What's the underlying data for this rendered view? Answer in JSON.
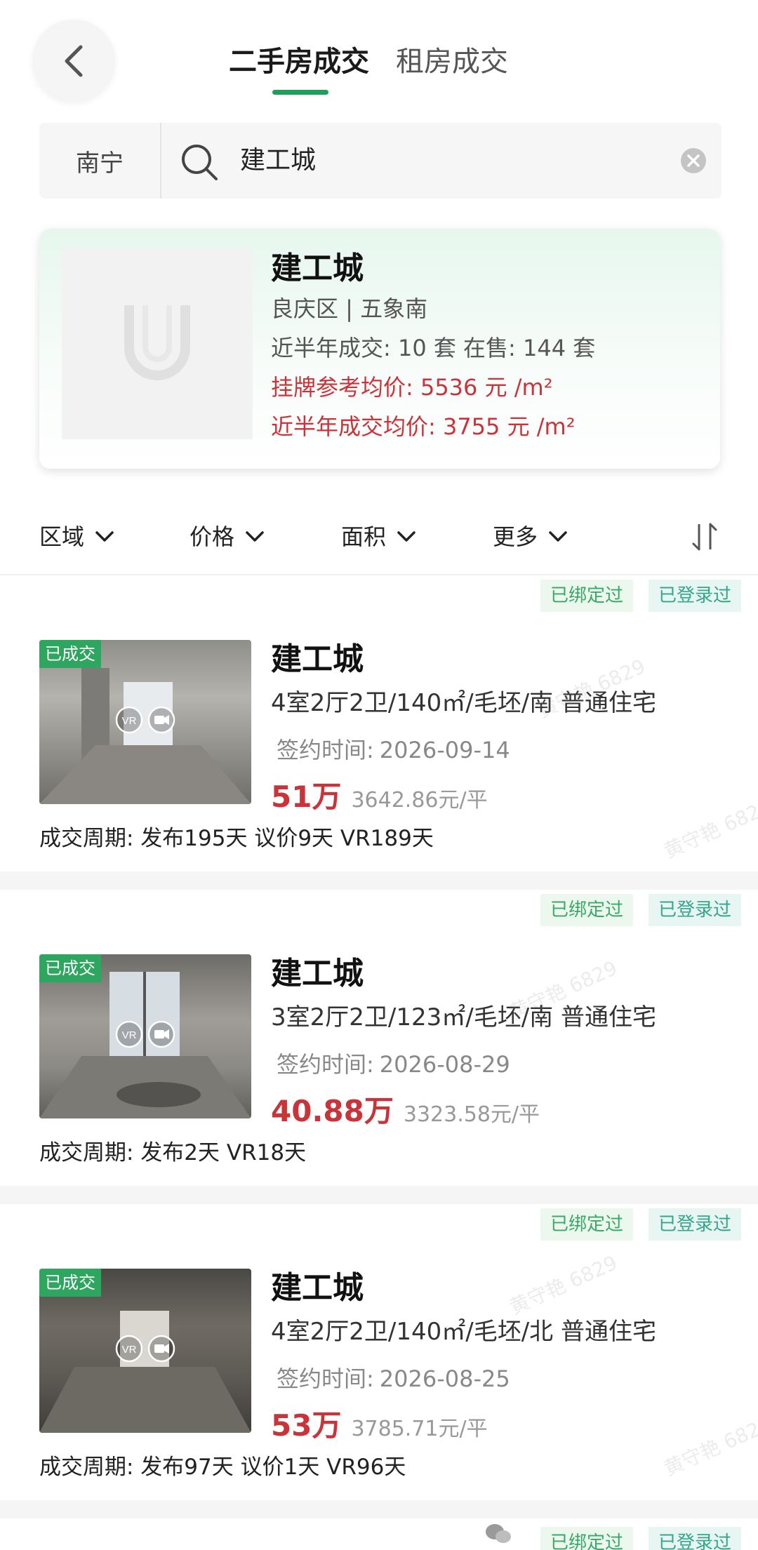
{
  "header": {
    "back_icon": "chevron-left-icon",
    "tabs": [
      {
        "label": "二手房成交",
        "active": true
      },
      {
        "label": "租房成交",
        "active": false
      }
    ],
    "accent_color": "#1f9e5e"
  },
  "search": {
    "city": "南宁",
    "query": "建工城",
    "search_icon": "search-icon",
    "clear_icon": "clear-icon"
  },
  "community": {
    "name": "建工城",
    "location": "良庆区 | 五象南",
    "recent_stats": "近半年成交: 10 套  在售: 144 套",
    "listing_avg": "挂牌参考均价: 5536 元 /m²",
    "deal_avg": "近半年成交均价: 3755 元 /m²",
    "price_color": "#c8343a"
  },
  "filters": [
    {
      "label": "区域"
    },
    {
      "label": "价格"
    },
    {
      "label": "面积"
    },
    {
      "label": "更多"
    }
  ],
  "listings": [
    {
      "tags": [
        "已绑定过",
        "已登录过"
      ],
      "badge": "已成交",
      "title": "建工城",
      "specs": "4室2厅2卫/140㎡/毛坯/南 普通住宅",
      "date_label": "签约时间:",
      "date": "2026-09-14",
      "price": "51万",
      "unit_price": "3642.86元/平",
      "cycle": "成交周期: 发布195天 议价9天 VR189天"
    },
    {
      "tags": [
        "已绑定过",
        "已登录过"
      ],
      "badge": "已成交",
      "title": "建工城",
      "specs": "3室2厅2卫/123㎡/毛坯/南 普通住宅",
      "date_label": "签约时间:",
      "date": "2026-08-29",
      "price": "40.88万",
      "unit_price": "3323.58元/平",
      "cycle": "成交周期: 发布2天 VR18天"
    },
    {
      "tags": [
        "已绑定过",
        "已登录过"
      ],
      "badge": "已成交",
      "title": "建工城",
      "specs": "4室2厅2卫/140㎡/毛坯/北 普通住宅",
      "date_label": "签约时间:",
      "date": "2026-08-25",
      "price": "53万",
      "unit_price": "3785.71元/平",
      "cycle": "成交周期: 发布97天 议价1天 VR96天"
    }
  ],
  "footer_tags": [
    "已绑定过",
    "已登录过"
  ],
  "watermark_text": "黄守艳 6829"
}
